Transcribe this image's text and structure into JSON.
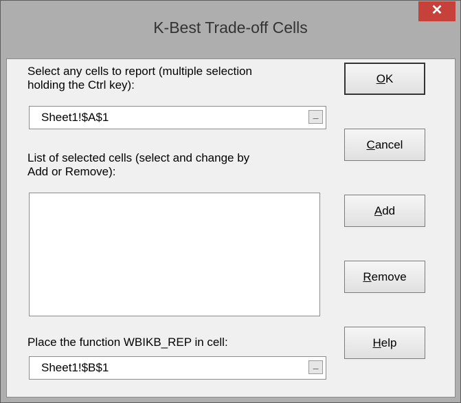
{
  "window": {
    "title": "K-Best Trade-off Cells",
    "close_symbol": "✕"
  },
  "select_cells": {
    "label_line1": "Select any cells to report (multiple selection",
    "label_line2": "holding the Ctrl key):",
    "value": "Sheet1!$A$1",
    "picker_symbol": "_"
  },
  "selected_list": {
    "label_line1": "List of selected cells (select and change by",
    "label_line2": "Add or Remove):",
    "items": []
  },
  "function_cell": {
    "label": "Place the function WBIKB_REP in cell:",
    "value": "Sheet1!$B$1",
    "picker_symbol": "_"
  },
  "buttons": {
    "ok": {
      "mnemonic": "O",
      "rest": "K"
    },
    "cancel": {
      "mnemonic": "C",
      "rest": "ancel"
    },
    "add": {
      "mnemonic": "A",
      "rest": "dd"
    },
    "remove": {
      "mnemonic": "R",
      "rest": "emove"
    },
    "help": {
      "mnemonic": "H",
      "rest": "elp"
    }
  },
  "colors": {
    "close_button": "#c7413b",
    "frame": "#aeaeae",
    "client": "#f0f0f0"
  }
}
